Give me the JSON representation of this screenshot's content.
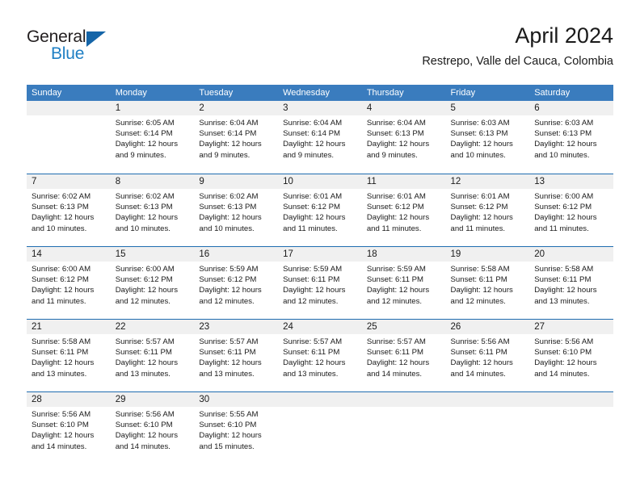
{
  "brand": {
    "line1": "General",
    "line2": "Blue",
    "triangle_color": "#1565a8",
    "blue_text_color": "#1f7fc4"
  },
  "header": {
    "title": "April 2024",
    "subtitle": "Restrepo, Valle del Cauca, Colombia"
  },
  "theme": {
    "header_row_bg": "#3a7cbe",
    "week_divider": "#1f6cb0",
    "day_number_bg": "#f0f0f0",
    "text": "#1a1a1a"
  },
  "weekdays": [
    "Sunday",
    "Monday",
    "Tuesday",
    "Wednesday",
    "Thursday",
    "Friday",
    "Saturday"
  ],
  "labels": {
    "sunrise_prefix": "Sunrise: ",
    "sunset_prefix": "Sunset: ",
    "daylight_prefix": "Daylight: "
  },
  "weeks": [
    [
      {
        "day": "",
        "sunrise": "",
        "sunset": "",
        "daylight_line1": "",
        "daylight_line2": ""
      },
      {
        "day": "1",
        "sunrise": "Sunrise: 6:05 AM",
        "sunset": "Sunset: 6:14 PM",
        "daylight_line1": "Daylight: 12 hours",
        "daylight_line2": "and 9 minutes."
      },
      {
        "day": "2",
        "sunrise": "Sunrise: 6:04 AM",
        "sunset": "Sunset: 6:14 PM",
        "daylight_line1": "Daylight: 12 hours",
        "daylight_line2": "and 9 minutes."
      },
      {
        "day": "3",
        "sunrise": "Sunrise: 6:04 AM",
        "sunset": "Sunset: 6:14 PM",
        "daylight_line1": "Daylight: 12 hours",
        "daylight_line2": "and 9 minutes."
      },
      {
        "day": "4",
        "sunrise": "Sunrise: 6:04 AM",
        "sunset": "Sunset: 6:13 PM",
        "daylight_line1": "Daylight: 12 hours",
        "daylight_line2": "and 9 minutes."
      },
      {
        "day": "5",
        "sunrise": "Sunrise: 6:03 AM",
        "sunset": "Sunset: 6:13 PM",
        "daylight_line1": "Daylight: 12 hours",
        "daylight_line2": "and 10 minutes."
      },
      {
        "day": "6",
        "sunrise": "Sunrise: 6:03 AM",
        "sunset": "Sunset: 6:13 PM",
        "daylight_line1": "Daylight: 12 hours",
        "daylight_line2": "and 10 minutes."
      }
    ],
    [
      {
        "day": "7",
        "sunrise": "Sunrise: 6:02 AM",
        "sunset": "Sunset: 6:13 PM",
        "daylight_line1": "Daylight: 12 hours",
        "daylight_line2": "and 10 minutes."
      },
      {
        "day": "8",
        "sunrise": "Sunrise: 6:02 AM",
        "sunset": "Sunset: 6:13 PM",
        "daylight_line1": "Daylight: 12 hours",
        "daylight_line2": "and 10 minutes."
      },
      {
        "day": "9",
        "sunrise": "Sunrise: 6:02 AM",
        "sunset": "Sunset: 6:13 PM",
        "daylight_line1": "Daylight: 12 hours",
        "daylight_line2": "and 10 minutes."
      },
      {
        "day": "10",
        "sunrise": "Sunrise: 6:01 AM",
        "sunset": "Sunset: 6:12 PM",
        "daylight_line1": "Daylight: 12 hours",
        "daylight_line2": "and 11 minutes."
      },
      {
        "day": "11",
        "sunrise": "Sunrise: 6:01 AM",
        "sunset": "Sunset: 6:12 PM",
        "daylight_line1": "Daylight: 12 hours",
        "daylight_line2": "and 11 minutes."
      },
      {
        "day": "12",
        "sunrise": "Sunrise: 6:01 AM",
        "sunset": "Sunset: 6:12 PM",
        "daylight_line1": "Daylight: 12 hours",
        "daylight_line2": "and 11 minutes."
      },
      {
        "day": "13",
        "sunrise": "Sunrise: 6:00 AM",
        "sunset": "Sunset: 6:12 PM",
        "daylight_line1": "Daylight: 12 hours",
        "daylight_line2": "and 11 minutes."
      }
    ],
    [
      {
        "day": "14",
        "sunrise": "Sunrise: 6:00 AM",
        "sunset": "Sunset: 6:12 PM",
        "daylight_line1": "Daylight: 12 hours",
        "daylight_line2": "and 11 minutes."
      },
      {
        "day": "15",
        "sunrise": "Sunrise: 6:00 AM",
        "sunset": "Sunset: 6:12 PM",
        "daylight_line1": "Daylight: 12 hours",
        "daylight_line2": "and 12 minutes."
      },
      {
        "day": "16",
        "sunrise": "Sunrise: 5:59 AM",
        "sunset": "Sunset: 6:12 PM",
        "daylight_line1": "Daylight: 12 hours",
        "daylight_line2": "and 12 minutes."
      },
      {
        "day": "17",
        "sunrise": "Sunrise: 5:59 AM",
        "sunset": "Sunset: 6:11 PM",
        "daylight_line1": "Daylight: 12 hours",
        "daylight_line2": "and 12 minutes."
      },
      {
        "day": "18",
        "sunrise": "Sunrise: 5:59 AM",
        "sunset": "Sunset: 6:11 PM",
        "daylight_line1": "Daylight: 12 hours",
        "daylight_line2": "and 12 minutes."
      },
      {
        "day": "19",
        "sunrise": "Sunrise: 5:58 AM",
        "sunset": "Sunset: 6:11 PM",
        "daylight_line1": "Daylight: 12 hours",
        "daylight_line2": "and 12 minutes."
      },
      {
        "day": "20",
        "sunrise": "Sunrise: 5:58 AM",
        "sunset": "Sunset: 6:11 PM",
        "daylight_line1": "Daylight: 12 hours",
        "daylight_line2": "and 13 minutes."
      }
    ],
    [
      {
        "day": "21",
        "sunrise": "Sunrise: 5:58 AM",
        "sunset": "Sunset: 6:11 PM",
        "daylight_line1": "Daylight: 12 hours",
        "daylight_line2": "and 13 minutes."
      },
      {
        "day": "22",
        "sunrise": "Sunrise: 5:57 AM",
        "sunset": "Sunset: 6:11 PM",
        "daylight_line1": "Daylight: 12 hours",
        "daylight_line2": "and 13 minutes."
      },
      {
        "day": "23",
        "sunrise": "Sunrise: 5:57 AM",
        "sunset": "Sunset: 6:11 PM",
        "daylight_line1": "Daylight: 12 hours",
        "daylight_line2": "and 13 minutes."
      },
      {
        "day": "24",
        "sunrise": "Sunrise: 5:57 AM",
        "sunset": "Sunset: 6:11 PM",
        "daylight_line1": "Daylight: 12 hours",
        "daylight_line2": "and 13 minutes."
      },
      {
        "day": "25",
        "sunrise": "Sunrise: 5:57 AM",
        "sunset": "Sunset: 6:11 PM",
        "daylight_line1": "Daylight: 12 hours",
        "daylight_line2": "and 14 minutes."
      },
      {
        "day": "26",
        "sunrise": "Sunrise: 5:56 AM",
        "sunset": "Sunset: 6:11 PM",
        "daylight_line1": "Daylight: 12 hours",
        "daylight_line2": "and 14 minutes."
      },
      {
        "day": "27",
        "sunrise": "Sunrise: 5:56 AM",
        "sunset": "Sunset: 6:10 PM",
        "daylight_line1": "Daylight: 12 hours",
        "daylight_line2": "and 14 minutes."
      }
    ],
    [
      {
        "day": "28",
        "sunrise": "Sunrise: 5:56 AM",
        "sunset": "Sunset: 6:10 PM",
        "daylight_line1": "Daylight: 12 hours",
        "daylight_line2": "and 14 minutes."
      },
      {
        "day": "29",
        "sunrise": "Sunrise: 5:56 AM",
        "sunset": "Sunset: 6:10 PM",
        "daylight_line1": "Daylight: 12 hours",
        "daylight_line2": "and 14 minutes."
      },
      {
        "day": "30",
        "sunrise": "Sunrise: 5:55 AM",
        "sunset": "Sunset: 6:10 PM",
        "daylight_line1": "Daylight: 12 hours",
        "daylight_line2": "and 15 minutes."
      },
      {
        "day": "",
        "sunrise": "",
        "sunset": "",
        "daylight_line1": "",
        "daylight_line2": ""
      },
      {
        "day": "",
        "sunrise": "",
        "sunset": "",
        "daylight_line1": "",
        "daylight_line2": ""
      },
      {
        "day": "",
        "sunrise": "",
        "sunset": "",
        "daylight_line1": "",
        "daylight_line2": ""
      },
      {
        "day": "",
        "sunrise": "",
        "sunset": "",
        "daylight_line1": "",
        "daylight_line2": ""
      }
    ]
  ]
}
